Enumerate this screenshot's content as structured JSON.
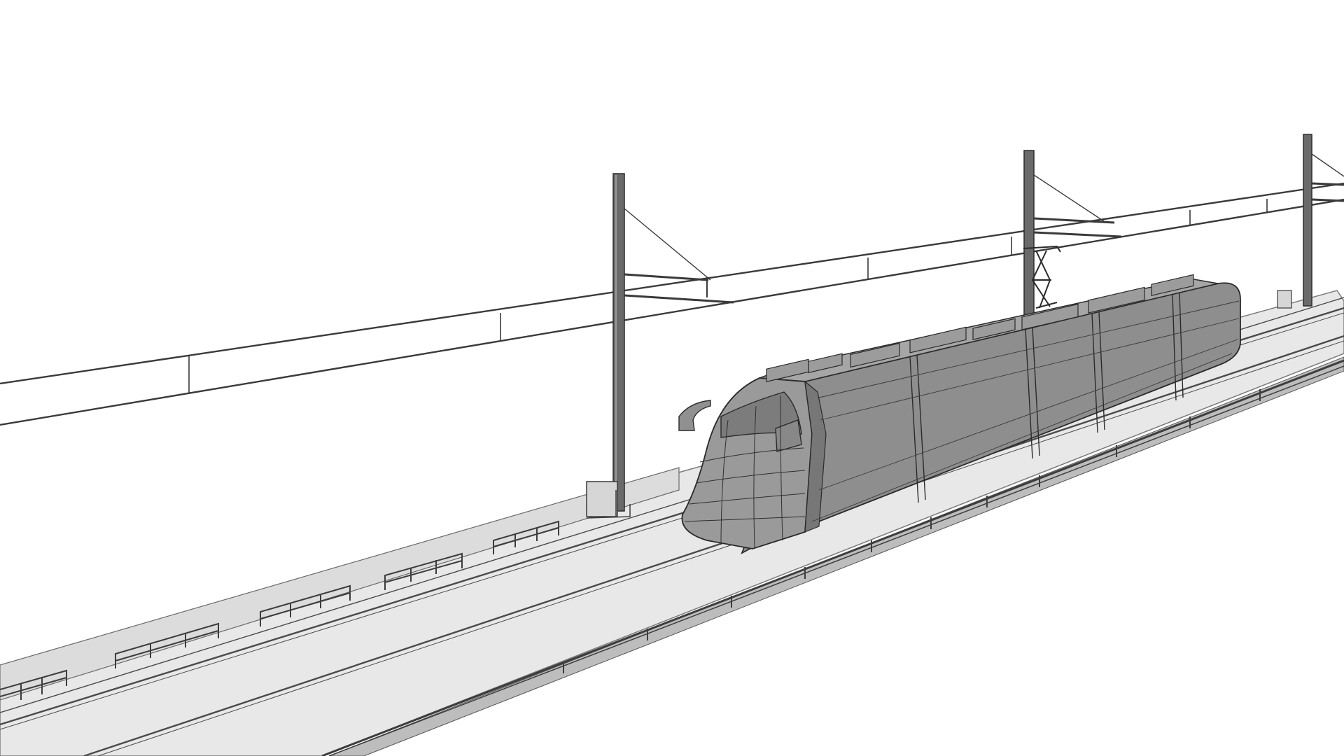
{
  "scene": {
    "subject": "wireframe-high-speed-train-on-viaduct",
    "colors": {
      "background": "#ffffff",
      "wire": "#3a3a3a",
      "deck_fill": "#e6e6e6",
      "deck_edge": "#5a5a5a",
      "rail": "#4a4a4a",
      "train_body": "#8e8e8e",
      "train_shadow": "#6f6f6f",
      "train_highlight": "#b2b2b2",
      "roof_equipment": "#9c9c9c",
      "mast": "#4d4d4d"
    },
    "counts": {
      "catenary_masts": 3,
      "train_car_segments": 5,
      "pantographs": 1,
      "fence_panels": 7
    }
  }
}
